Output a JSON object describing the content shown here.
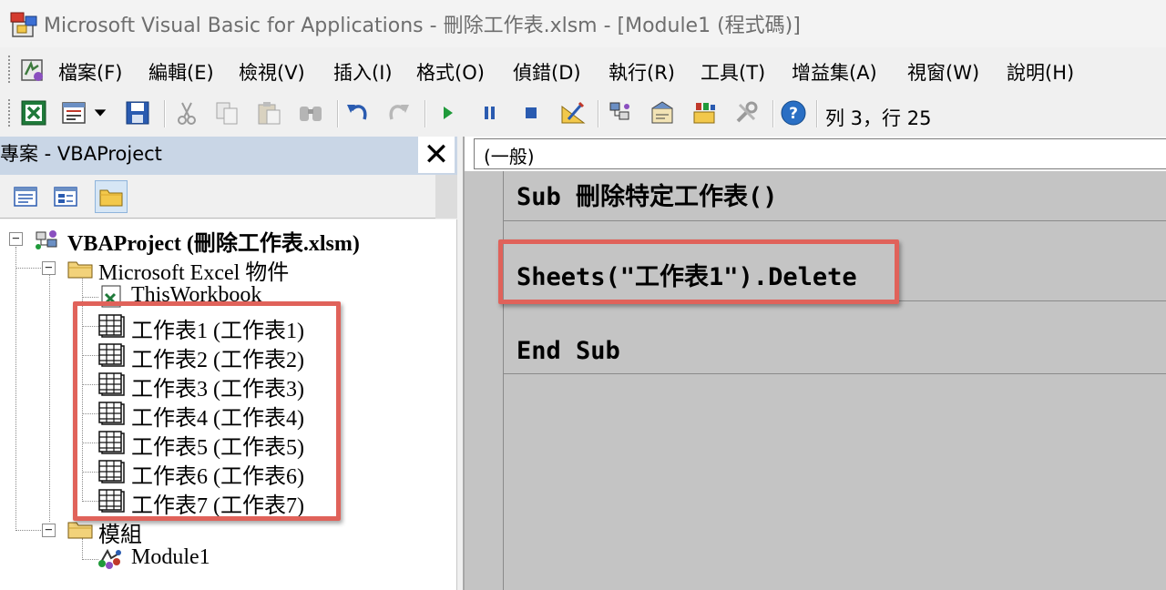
{
  "window": {
    "title": "Microsoft Visual Basic for Applications - 刪除工作表.xlsm - [Module1 (程式碼)]"
  },
  "menu": {
    "items": [
      {
        "label": "檔案(F)"
      },
      {
        "label": "編輯(E)"
      },
      {
        "label": "檢視(V)"
      },
      {
        "label": "插入(I)"
      },
      {
        "label": "格式(O)"
      },
      {
        "label": "偵錯(D)"
      },
      {
        "label": "執行(R)"
      },
      {
        "label": "工具(T)"
      },
      {
        "label": "增益集(A)"
      },
      {
        "label": "視窗(W)"
      },
      {
        "label": "說明(H)"
      }
    ]
  },
  "toolbar": {
    "buttons": [
      {
        "icon": "excel-view-icon"
      },
      {
        "icon": "insert-userform-icon"
      },
      {
        "icon": "dropdown-arrow-icon"
      },
      {
        "icon": "save-icon"
      },
      {
        "icon": "cut-icon"
      },
      {
        "icon": "copy-icon"
      },
      {
        "icon": "paste-icon"
      },
      {
        "icon": "find-icon"
      },
      {
        "icon": "undo-icon"
      },
      {
        "icon": "redo-icon"
      },
      {
        "icon": "run-icon"
      },
      {
        "icon": "break-icon"
      },
      {
        "icon": "reset-icon"
      },
      {
        "icon": "design-mode-icon"
      },
      {
        "icon": "project-explorer-icon"
      },
      {
        "icon": "properties-window-icon"
      },
      {
        "icon": "object-browser-icon"
      },
      {
        "icon": "toolbox-icon"
      },
      {
        "icon": "help-icon"
      }
    ],
    "cursor_position": "列 3，行 25"
  },
  "project_panel": {
    "title": "專案 - VBAProject",
    "close_label": "✕",
    "view_buttons": [
      {
        "icon": "view-code-icon"
      },
      {
        "icon": "view-object-icon"
      },
      {
        "icon": "toggle-folders-icon",
        "pressed": true
      }
    ],
    "tree": {
      "root": "VBAProject (刪除工作表.xlsm)",
      "excel_objects_folder": "Microsoft Excel 物件",
      "workbook": "ThisWorkbook",
      "sheets": [
        {
          "label": "工作表1 (工作表1)"
        },
        {
          "label": "工作表2 (工作表2)"
        },
        {
          "label": "工作表3 (工作表3)"
        },
        {
          "label": "工作表4 (工作表4)"
        },
        {
          "label": "工作表5 (工作表5)"
        },
        {
          "label": "工作表6 (工作表6)"
        },
        {
          "label": "工作表7 (工作表7)"
        }
      ],
      "modules_folder": "模組",
      "module": "Module1"
    }
  },
  "code_window": {
    "object_selector": "(一般)",
    "lines": [
      "Sub 刪除特定工作表()",
      "",
      "Sheets(\"工作表1\").Delete",
      "",
      "End Sub"
    ]
  },
  "colors": {
    "highlight_box": "#e0625a",
    "panel_header": "#c9d6e6",
    "code_background": "#c4c4c4"
  }
}
